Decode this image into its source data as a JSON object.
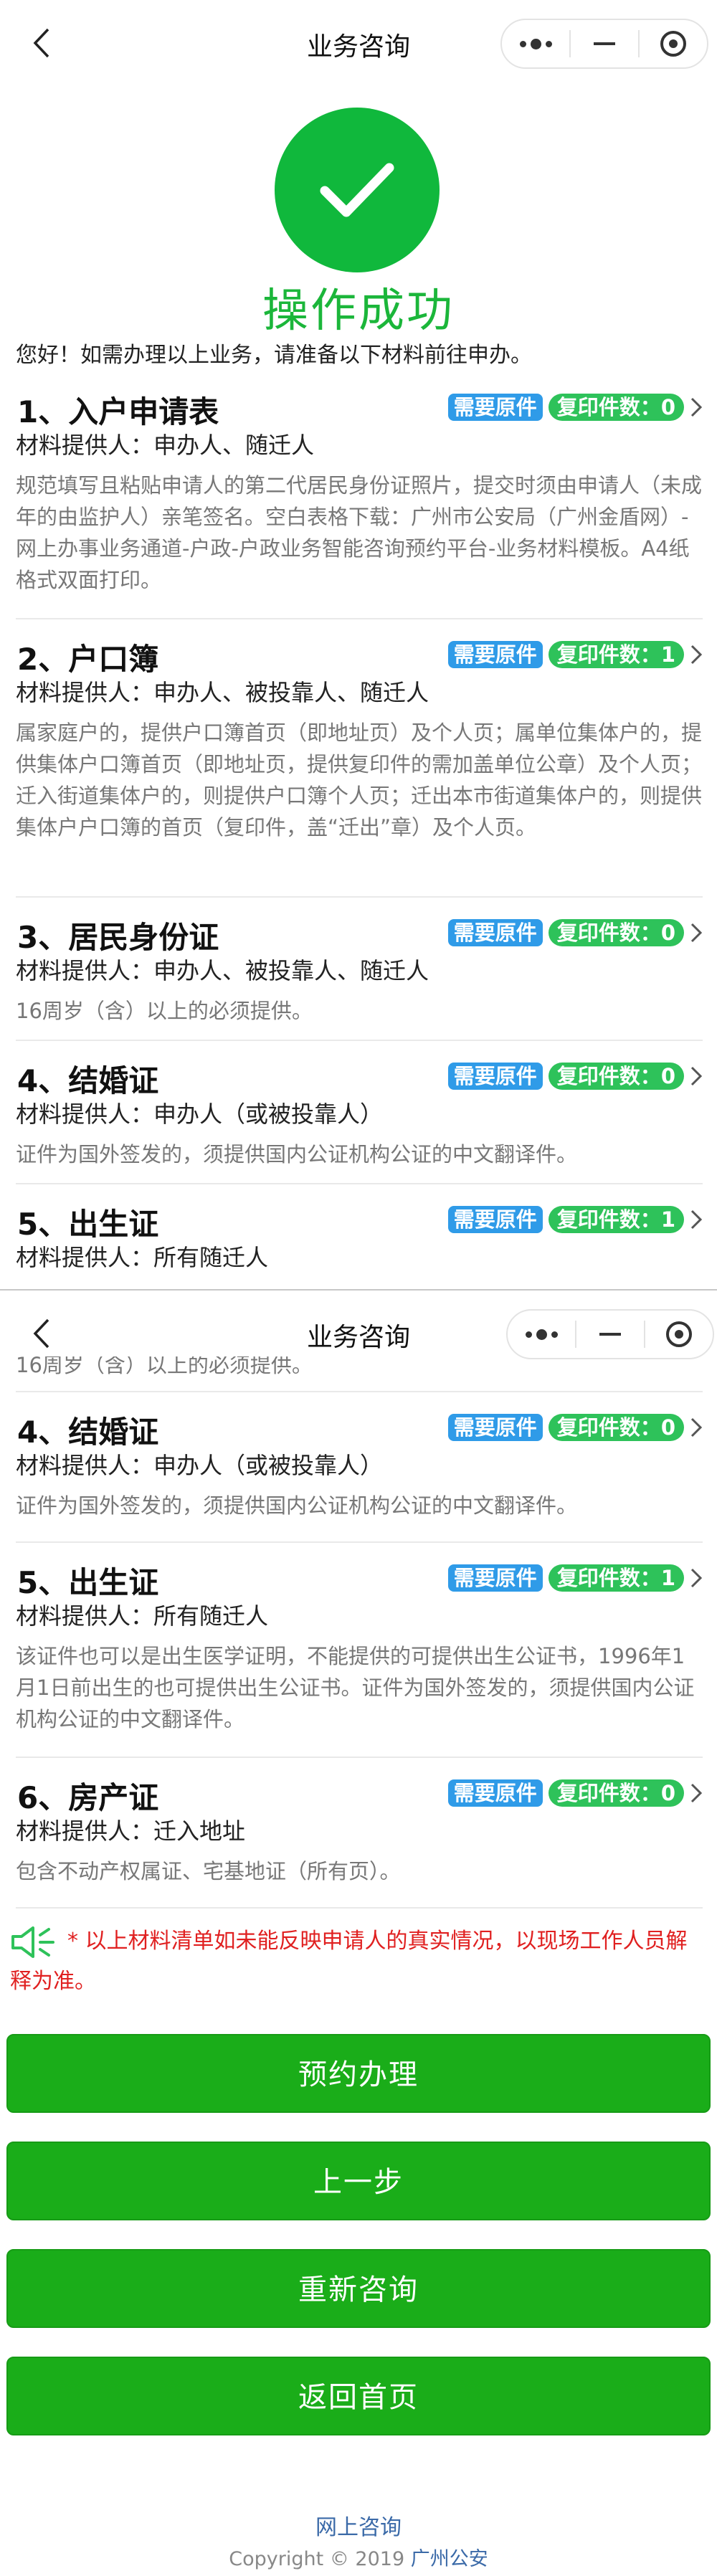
{
  "nav": {
    "title": "业务咨询",
    "back_icon": "chevron-left-icon",
    "more_icon": "more-dots-icon",
    "minimize_icon": "minus-icon",
    "close_icon": "target-icon"
  },
  "success": {
    "icon": "checkmark-icon",
    "title": "操作成功",
    "intro": "您好！如需办理以上业务，请准备以下材料前往申办。"
  },
  "badge_labels": {
    "original": "需要原件",
    "copies_prefix": "复印件数："
  },
  "colors": {
    "accent_green": "#1aad19",
    "badge_blue": "#2f9be8",
    "badge_green": "#2ec25a",
    "notice_red": "#e02020",
    "success_green": "#10b83c"
  },
  "items": [
    {
      "title": "1、入户申请表",
      "copies": "0",
      "provider": "材料提供人：申办人、随迁人",
      "desc": "规范填写且粘贴申请人的第二代居民身份证照片，提交时须由申请人（未成年的由监护人）亲笔签名。空白表格下载：广州市公安局（广州金盾网）-网上办事业务通道-户政-户政业务智能咨询预约平台-业务材料模板。A4纸格式双面打印。"
    },
    {
      "title": "2、户口簿",
      "copies": "1",
      "provider": "材料提供人：申办人、被投靠人、随迁人",
      "desc": "属家庭户的，提供户口簿首页（即地址页）及个人页；属单位集体户的，提供集体户口簿首页（即地址页，提供复印件的需加盖单位公章）及个人页；迁入街道集体户的，则提供户口簿个人页；迁出本市街道集体户的，则提供集体户户口簿的首页（复印件，盖“迁出”章）及个人页。"
    },
    {
      "title": "3、居民身份证",
      "copies": "0",
      "provider": "材料提供人：申办人、被投靠人、随迁人",
      "desc": "16周岁（含）以上的必须提供。"
    },
    {
      "title": "4、结婚证",
      "copies": "0",
      "provider": "材料提供人：申办人（或被投靠人）",
      "desc": "证件为国外签发的，须提供国内公证机构公证的中文翻译件。"
    },
    {
      "title": "5、出生证",
      "copies": "1",
      "provider": "材料提供人：所有随迁人",
      "desc": "该证件也可以是出生医学证明，不能提供的可提供出生公证书，1996年1月1日前出生的也可提供出生公证书。证件为国外签发的，须提供国内公证机构公证的中文翻译件。"
    },
    {
      "title": "6、房产证",
      "copies": "0",
      "provider": "材料提供人：迁入地址",
      "desc": "包含不动产权属证、宅基地证（所有页）。"
    }
  ],
  "notice": {
    "icon": "speaker-icon",
    "text": "* 以上材料清单如未能反映申请人的真实情况，以现场工作人员解释为准。"
  },
  "buttons": {
    "book": "预约办理",
    "prev": "上一步",
    "restart": "重新咨询",
    "home": "返回首页"
  },
  "footer": {
    "link": "网上咨询",
    "copyright": "Copyright",
    "symbol": "©",
    "year": "2019",
    "org": "广州公安"
  }
}
